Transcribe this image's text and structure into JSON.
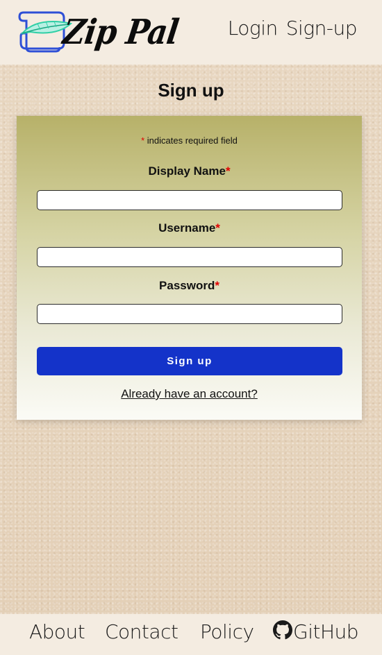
{
  "header": {
    "brand": "Zip Pal",
    "nav": {
      "login": "Login",
      "signup": "Sign-up"
    }
  },
  "page": {
    "title": "Sign up"
  },
  "form": {
    "required_asterisk": "*",
    "required_note": "indicates required field",
    "fields": [
      {
        "label": "Display Name",
        "value": "",
        "placeholder": ""
      },
      {
        "label": "Username",
        "value": "",
        "placeholder": ""
      },
      {
        "label": "Password",
        "value": "",
        "placeholder": ""
      }
    ],
    "submit_label": "Sign up",
    "alt_link": "Already have an account?"
  },
  "footer": {
    "about": "About",
    "contact": "Contact",
    "policy": "Policy",
    "github": "GitHub",
    "github_icon": "github-icon"
  },
  "colors": {
    "primary_button": "#1433c9",
    "required": "#e10000",
    "card_top": "#b7b169",
    "card_bottom": "#fbfbf6",
    "bar_background": "#f4ece1"
  }
}
